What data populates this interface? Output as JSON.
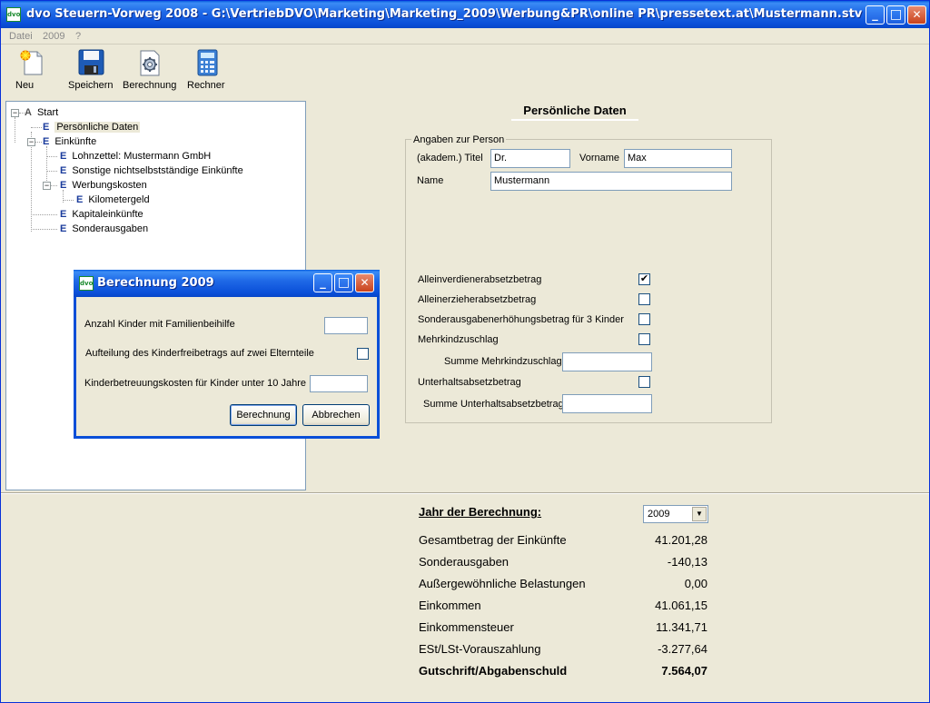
{
  "window": {
    "title": "dvo Steuern-Vorweg 2008 - G:\\VertriebDVO\\Marketing\\Marketing_2009\\Werbung&PR\\online PR\\pressetext.at\\Mustermann.stv",
    "app_icon": "dvo",
    "controls": {
      "minimize": "_",
      "maximize": "□",
      "close": "✕"
    }
  },
  "menu": [
    "Datei",
    "2009",
    "?"
  ],
  "toolbar": {
    "new": "Neu",
    "save": "Speichern",
    "calc": "Berechnung",
    "calculator": "Rechner"
  },
  "tree": {
    "start": {
      "letter": "A",
      "label": "Start"
    },
    "personal": {
      "letter": "E",
      "label": "Persönliche Daten"
    },
    "income": {
      "letter": "E",
      "label": "Einkünfte"
    },
    "payslip": {
      "letter": "E",
      "label": "Lohnzettel: Mustermann GmbH"
    },
    "other_income": {
      "letter": "E",
      "label": "Sonstige nichtselbstständige Einkünfte"
    },
    "expenses": {
      "letter": "E",
      "label": "Werbungskosten"
    },
    "mileage": {
      "letter": "E",
      "label": "Kilometergeld"
    },
    "capital": {
      "letter": "E",
      "label": "Kapitaleinkünfte"
    },
    "special": {
      "letter": "E",
      "label": "Sonderausgaben"
    }
  },
  "form": {
    "heading": "Persönliche Daten",
    "group_label": "Angaben zur Person",
    "title_label": "(akadem.) Titel",
    "title_value": "Dr.",
    "firstname_label": "Vorname",
    "firstname_value": "Max",
    "name_label": "Name",
    "name_value": "Mustermann",
    "sole_earner": {
      "label": "Alleinverdienerabsetzbetrag",
      "checked": true,
      "mark": "✔"
    },
    "single_parent": {
      "label": "Alleinerzieherabsetzbetrag",
      "checked": false
    },
    "special_increase": {
      "label": "Sonderausgabenerhöhungsbetrag für 3 Kinder",
      "checked": false
    },
    "multi_child": {
      "label": "Mehrkindzuschlag",
      "checked": false
    },
    "multi_child_sum": {
      "label": "Summe Mehrkindzuschlag",
      "value": ""
    },
    "maintenance": {
      "label": "Unterhaltsabsetzbetrag",
      "checked": false
    },
    "maintenance_sum": {
      "label": "Summe Unterhaltsabsetzbetrag",
      "value": ""
    }
  },
  "summary": {
    "year_label": "Jahr der Berechnung:",
    "year_value": "2009",
    "rows": [
      {
        "label": "Gesamtbetrag der Einkünfte",
        "value": "41.201,28"
      },
      {
        "label": "Sonderausgaben",
        "value": "-140,13"
      },
      {
        "label": "Außergewöhnliche Belastungen",
        "value": "0,00"
      },
      {
        "label": "Einkommen",
        "value": "41.061,15"
      },
      {
        "label": "Einkommensteuer",
        "value": "11.341,71"
      },
      {
        "label": "ESt/LSt-Vorauszahlung",
        "value": "-3.277,64"
      },
      {
        "label": "Gutschrift/Abgabenschuld",
        "value": "7.564,07"
      }
    ]
  },
  "dialog": {
    "title": "Berechnung 2009",
    "children_label": "Anzahl Kinder mit Familienbeihilfe",
    "children_value": "",
    "split_label": "Aufteilung des Kinderfreibetrags auf zwei Elternteile",
    "split_checked": false,
    "childcare_label": "Kinderbetreuungskosten für Kinder unter 10 Jahre",
    "childcare_value": "",
    "ok_button": "Berechnung",
    "cancel_button": "Abbrechen"
  }
}
